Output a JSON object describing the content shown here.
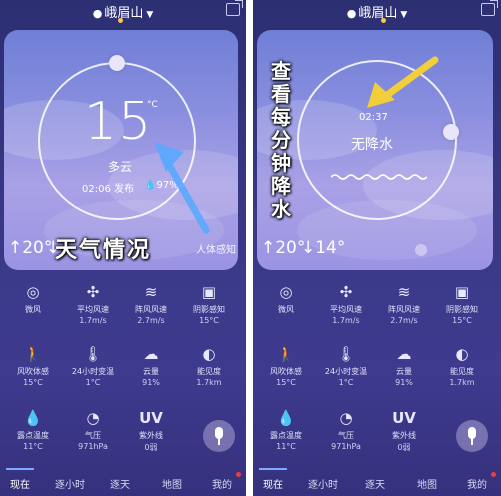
{
  "left": {
    "location": "峨眉山",
    "temperature": "15",
    "temp_unit": "°C",
    "condition": "多云",
    "publish": "02:06 发布",
    "humidity": "97%",
    "high": "↑20°",
    "low": "↓",
    "feels_like": "人体感知",
    "overlay_caption": "天气情况"
  },
  "right": {
    "location": "峨眉山",
    "time": "02:37",
    "precip_status": "无降水",
    "high": "↑20°",
    "low": "↓14°",
    "overlay_caption": [
      "查",
      "看",
      "每",
      "分",
      "钟",
      "降",
      "水"
    ]
  },
  "details": [
    {
      "icon": "compass-icon",
      "label": "微风",
      "value": ""
    },
    {
      "icon": "wind-icon",
      "label": "平均风速",
      "value": "1.7m/s"
    },
    {
      "icon": "gust-icon",
      "label": "阵风风速",
      "value": "2.7m/s"
    },
    {
      "icon": "shade-icon",
      "label": "阴影感知",
      "value": "15°C"
    },
    {
      "icon": "windchill-icon",
      "label": "风吹体感",
      "value": "15°C"
    },
    {
      "icon": "thermometer-icon",
      "label": "24小时变温",
      "value": "1°C"
    },
    {
      "icon": "cloud-icon",
      "label": "云量",
      "value": "91%"
    },
    {
      "icon": "visibility-icon",
      "label": "能见度",
      "value": "1.7km"
    },
    {
      "icon": "dewpoint-icon",
      "label": "露点温度",
      "value": "11°C"
    },
    {
      "icon": "pressure-icon",
      "label": "气压",
      "value": "971hPa"
    },
    {
      "icon": "uv-icon",
      "label": "紫外线",
      "value": "0弱"
    }
  ],
  "tabs": [
    "现在",
    "逐小时",
    "逐天",
    "地图",
    "我的"
  ],
  "colors": {
    "background": "#36317d",
    "card_top": "#6f7fd6",
    "card_bottom": "#9b94e3",
    "accent_dot": "#f5c84a",
    "tab_indicator": "#7fa8ff",
    "notification": "#e54040",
    "annotation_arrow": "#f2cf3a"
  }
}
